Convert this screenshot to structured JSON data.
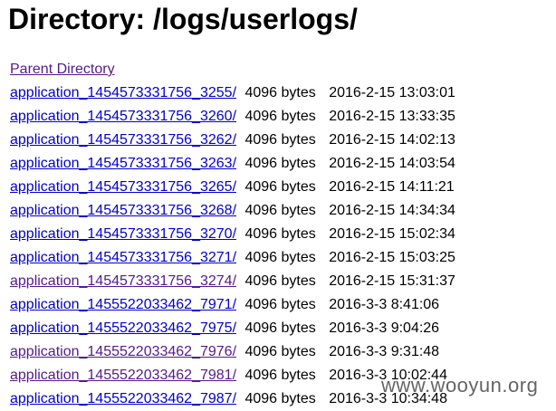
{
  "heading": "Directory: /logs/userlogs/",
  "parent_link": "Parent Directory",
  "rows": [
    {
      "name": "application_1454573331756_3255/",
      "size": "4096 bytes",
      "date": "2016-2-15 13:03:01"
    },
    {
      "name": "application_1454573331756_3260/",
      "size": "4096 bytes",
      "date": "2016-2-15 13:33:35"
    },
    {
      "name": "application_1454573331756_3262/",
      "size": "4096 bytes",
      "date": "2016-2-15 14:02:13"
    },
    {
      "name": "application_1454573331756_3263/",
      "size": "4096 bytes",
      "date": "2016-2-15 14:03:54"
    },
    {
      "name": "application_1454573331756_3265/",
      "size": "4096 bytes",
      "date": "2016-2-15 14:11:21"
    },
    {
      "name": "application_1454573331756_3268/",
      "size": "4096 bytes",
      "date": "2016-2-15 14:34:34"
    },
    {
      "name": "application_1454573331756_3270/",
      "size": "4096 bytes",
      "date": "2016-2-15 15:02:34"
    },
    {
      "name": "application_1454573331756_3271/",
      "size": "4096 bytes",
      "date": "2016-2-15 15:03:25"
    },
    {
      "name": "application_1454573331756_3274/",
      "size": "4096 bytes",
      "date": "2016-2-15 15:31:37"
    },
    {
      "name": "application_1455522033462_7971/",
      "size": "4096 bytes",
      "date": "2016-3-3 8:41:06"
    },
    {
      "name": "application_1455522033462_7975/",
      "size": "4096 bytes",
      "date": "2016-3-3 9:04:26"
    },
    {
      "name": "application_1455522033462_7976/",
      "size": "4096 bytes",
      "date": "2016-3-3 9:31:48"
    },
    {
      "name": "application_1455522033462_7981/",
      "size": "4096 bytes",
      "date": "2016-3-3 10:02:44"
    },
    {
      "name": "application_1455522033462_7987/",
      "size": "4096 bytes",
      "date": "2016-3-3 10:34:48"
    }
  ],
  "watermark": "www.wooyun.org",
  "colors": {
    "link_unvisited": "#0000cc",
    "link_visited": "#551a8b",
    "text": "#000000",
    "background": "#ffffff"
  }
}
